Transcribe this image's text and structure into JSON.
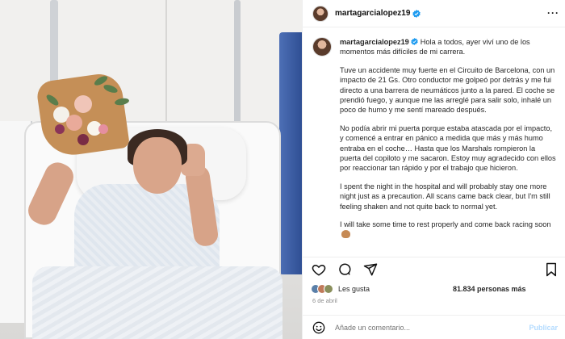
{
  "post": {
    "username": "martagarcialopez19",
    "caption_paragraphs": [
      "Hola a todos, ayer viví uno de los momentos más difíciles de mi carrera.",
      "Tuve un accidente muy fuerte en el Circuito de Barcelona, con un impacto de 21 Gs. Otro conductor me golpeó por detrás y me fui directo a una barrera de neumáticos junto a la pared. El coche se prendió fuego, y aunque me las arreglé para salir solo, inhalé un poco de humo y me sentí mareado después.",
      "No podía abrir mi puerta porque estaba atascada por el impacto, y comencé a entrar en pánico a medida que más y más humo entraba en el coche… Hasta que los Marshals rompieron la puerta del copiloto y me sacaron. Estoy muy agradecido con ellos por reaccionar tan rápido y por el trabajo que hicieron.",
      "I spent the night in the hospital and will probably stay one more night just as a precaution. All scans came back clear, but I'm still feeling shaken and not quite back to normal yet.",
      "I will take some time to rest properly and come back racing soon"
    ],
    "likes_label": "Les gusta",
    "likes_count": "81.834 personas más",
    "date": "6 de abril",
    "comment_placeholder": "Añade un comentario...",
    "publish_label": "Publicar"
  },
  "icons": {
    "verified": "verified-badge-icon",
    "more": "more-options-icon",
    "like": "heart-icon",
    "comment": "comment-icon",
    "share": "send-icon",
    "save": "bookmark-icon",
    "emoji": "emoji-icon"
  },
  "colors": {
    "verified_blue": "#1d9bf0",
    "publish_disabled": "#b3dbff",
    "muted_text": "#8e8e8e"
  }
}
